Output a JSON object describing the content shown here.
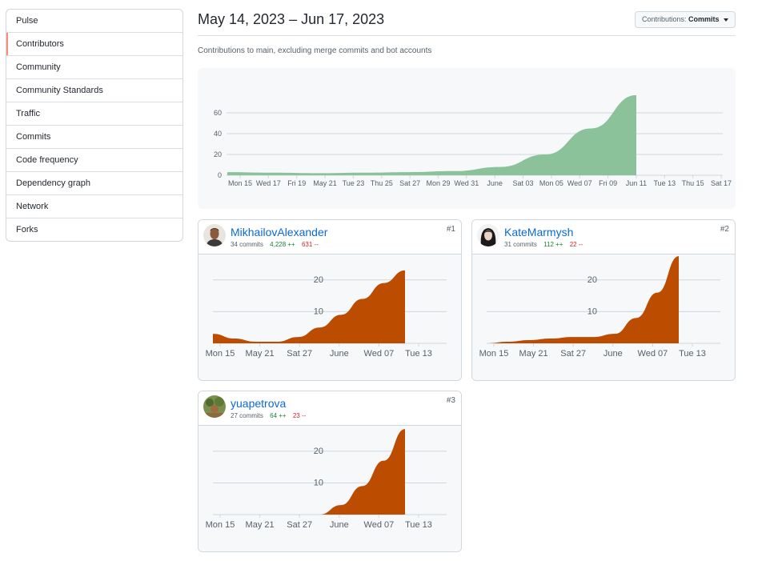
{
  "sidebar": {
    "items": [
      {
        "label": "Pulse"
      },
      {
        "label": "Contributors"
      },
      {
        "label": "Community"
      },
      {
        "label": "Community Standards"
      },
      {
        "label": "Traffic"
      },
      {
        "label": "Commits"
      },
      {
        "label": "Code frequency"
      },
      {
        "label": "Dependency graph"
      },
      {
        "label": "Network"
      },
      {
        "label": "Forks"
      }
    ],
    "selected_index": 1
  },
  "header": {
    "title": "May 14, 2023 – Jun 17, 2023",
    "subtitle": "Contributions to main, excluding merge commits and bot accounts",
    "dropdown_prefix": "Contributions:",
    "dropdown_value": "Commits"
  },
  "colors": {
    "main_area": "#8cc29a",
    "user_area": "#bc4c00",
    "link": "#0969da",
    "additions": "#1a7f37",
    "deletions": "#cf222e"
  },
  "chart_data": [
    {
      "type": "area",
      "x": [
        "May 14",
        "May 17",
        "May 21",
        "May 24",
        "May 28",
        "May 31",
        "Jun 03",
        "Jun 06",
        "Jun 09",
        "Jun 11"
      ],
      "values": [
        3,
        2.5,
        2,
        2.5,
        3,
        4,
        8,
        20,
        45,
        77
      ],
      "xticks": [
        "Mon 15",
        "Wed 17",
        "Fri 19",
        "May 21",
        "Tue 23",
        "Thu 25",
        "Sat 27",
        "Mon 29",
        "Wed 31",
        "June",
        "Sat 03",
        "Mon 05",
        "Wed 07",
        "Fri 09",
        "Jun 11",
        "Tue 13",
        "Thu 15",
        "Sat 17"
      ],
      "yticks": [
        "0",
        "20",
        "40",
        "60"
      ],
      "ylim": [
        0,
        80
      ],
      "grid": true
    },
    {
      "type": "area",
      "user": "MikhailovAlexander",
      "x": [
        "May 14",
        "May 17",
        "May 21",
        "May 24",
        "May 28",
        "May 31",
        "Jun 03",
        "Jun 06",
        "Jun 09",
        "Jun 11"
      ],
      "values": [
        3,
        1.5,
        0.5,
        0.5,
        2,
        5,
        9,
        14,
        19,
        23
      ],
      "xticks": [
        "Mon 15",
        "May 21",
        "Sat 27",
        "June",
        "Wed 07",
        "Tue 13"
      ],
      "yticks": [
        "10",
        "20"
      ],
      "ylim": [
        0,
        25
      ],
      "grid": true
    },
    {
      "type": "area",
      "user": "KateMarmysh",
      "x": [
        "May 14",
        "May 17",
        "May 21",
        "May 24",
        "May 28",
        "May 31",
        "Jun 03",
        "Jun 06",
        "Jun 09",
        "Jun 11"
      ],
      "values": [
        0,
        0.5,
        1,
        1.5,
        2,
        2,
        3,
        8,
        16,
        27.5
      ],
      "xticks": [
        "Mon 15",
        "May 21",
        "Sat 27",
        "June",
        "Wed 07",
        "Tue 13"
      ],
      "yticks": [
        "10",
        "20"
      ],
      "ylim": [
        0,
        25
      ],
      "grid": true
    },
    {
      "type": "area",
      "user": "yuapetrova",
      "x": [
        "May 14",
        "May 17",
        "May 21",
        "May 24",
        "May 28",
        "May 31",
        "Jun 03",
        "Jun 06",
        "Jun 09",
        "Jun 11"
      ],
      "values": [
        0,
        0,
        0,
        0,
        0,
        0,
        3,
        9,
        17,
        27
      ],
      "xticks": [
        "Mon 15",
        "May 21",
        "Sat 27",
        "June",
        "Wed 07",
        "Tue 13"
      ],
      "yticks": [
        "10",
        "20"
      ],
      "ylim": [
        0,
        25
      ],
      "grid": true
    }
  ],
  "contributors": [
    {
      "rank": "#1",
      "username": "MikhailovAlexander",
      "commits": "34 commits",
      "additions": "4,228 ++",
      "deletions": "631 --",
      "avatar": "person-photo-male"
    },
    {
      "rank": "#2",
      "username": "KateMarmysh",
      "commits": "31 commits",
      "additions": "112 ++",
      "deletions": "22 --",
      "avatar": "person-photo-female"
    },
    {
      "rank": "#3",
      "username": "yuapetrova",
      "commits": "27 commits",
      "additions": "64 ++",
      "deletions": "23 --",
      "avatar": "nature-photo"
    }
  ]
}
